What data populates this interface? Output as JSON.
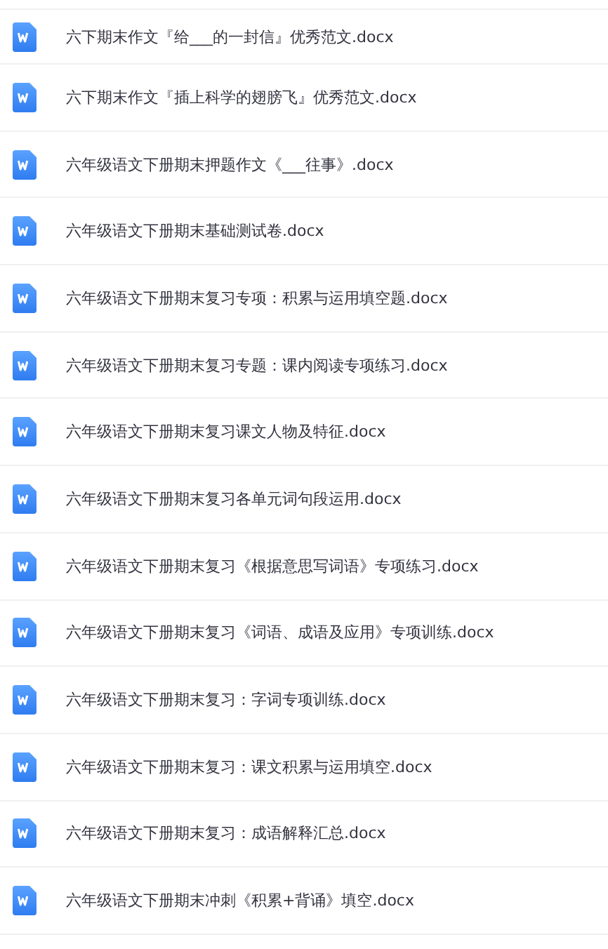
{
  "files": [
    {
      "name": "六下期末作文『给___的一封信』优秀范文.docx",
      "kind": "word"
    },
    {
      "name": "六下期末作文『插上科学的翅膀飞』优秀范文.docx",
      "kind": "word"
    },
    {
      "name": "六年级语文下册期末押题作文《___往事》.docx",
      "kind": "word"
    },
    {
      "name": "六年级语文下册期末基础测试卷.docx",
      "kind": "word"
    },
    {
      "name": "六年级语文下册期末复习专项：积累与运用填空题.docx",
      "kind": "word"
    },
    {
      "name": "六年级语文下册期末复习专题：课内阅读专项练习.docx",
      "kind": "word"
    },
    {
      "name": "六年级语文下册期末复习课文人物及特征.docx",
      "kind": "word"
    },
    {
      "name": "六年级语文下册期末复习各单元词句段运用.docx",
      "kind": "word"
    },
    {
      "name": "六年级语文下册期末复习《根据意思写词语》专项练习.docx",
      "kind": "word"
    },
    {
      "name": "六年级语文下册期末复习《词语、成语及应用》专项训练.docx",
      "kind": "word"
    },
    {
      "name": "六年级语文下册期末复习：字词专项训练.docx",
      "kind": "word"
    },
    {
      "name": "六年级语文下册期末复习：课文积累与运用填空.docx",
      "kind": "word"
    },
    {
      "name": "六年级语文下册期末复习：成语解释汇总.docx",
      "kind": "word"
    },
    {
      "name": "六年级语文下册期末冲刺《积累+背诵》填空.docx",
      "kind": "word"
    }
  ]
}
